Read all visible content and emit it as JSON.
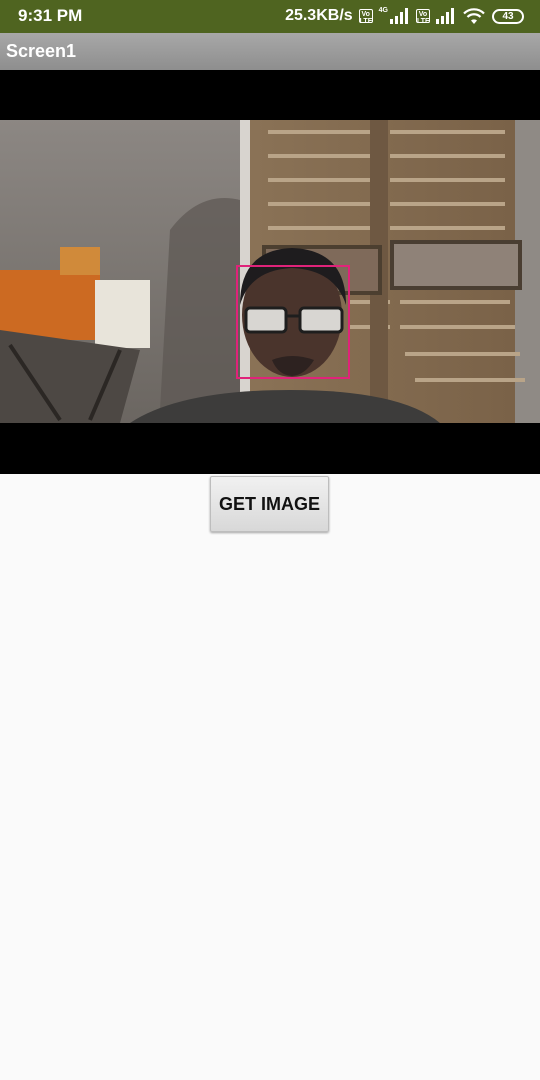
{
  "status_bar": {
    "time": "9:31 PM",
    "network_speed": "25.3KB/s",
    "volte_label": "Vo LTE",
    "network_type": "4G",
    "battery_level": "43",
    "icons": [
      "volte-icon",
      "signal-icon",
      "volte-icon",
      "signal-icon",
      "wifi-icon",
      "battery-icon"
    ]
  },
  "title_bar": {
    "title": "Screen1"
  },
  "camera": {
    "face_box_color": "#e0237a"
  },
  "actions": {
    "get_image_label": "GET IMAGE"
  },
  "colors": {
    "status_bar_bg": "#4f6420",
    "title_bar_bg": "#9a9a9a",
    "page_bg": "#fafafa"
  }
}
